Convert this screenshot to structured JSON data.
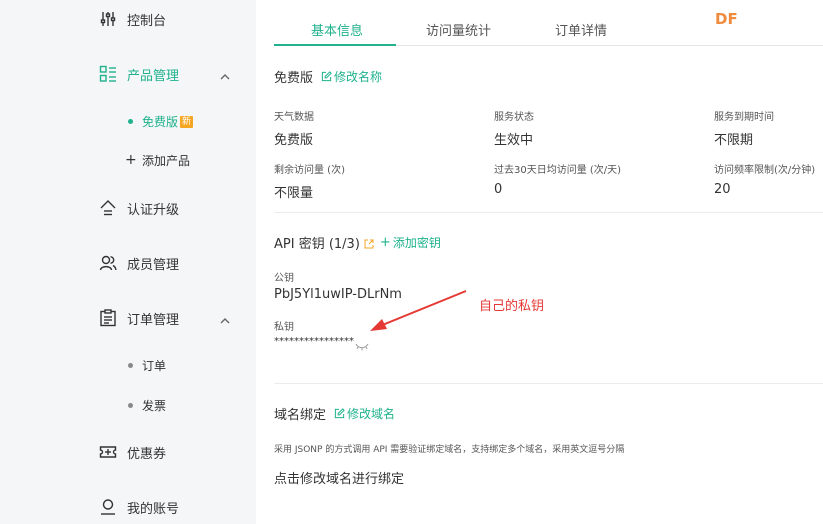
{
  "brand": "DF",
  "sidebar": {
    "items": [
      {
        "label": "控制台",
        "icon": "sliders-icon"
      },
      {
        "label": "产品管理",
        "icon": "grid-list-icon"
      },
      {
        "label": "认证升级",
        "icon": "upgrade-icon"
      },
      {
        "label": "成员管理",
        "icon": "members-icon"
      },
      {
        "label": "订单管理",
        "icon": "clipboard-icon"
      },
      {
        "label": "优惠券",
        "icon": "coupon-icon"
      },
      {
        "label": "我的账号",
        "icon": "user-icon"
      }
    ],
    "product_sub": {
      "free": "免费版",
      "new_badge": "新",
      "add": "添加产品"
    },
    "order_sub": {
      "orders": "订单",
      "invoice": "发票"
    }
  },
  "tabs": [
    "基本信息",
    "访问量统计",
    "订单详情"
  ],
  "plan": {
    "title": "免费版",
    "edit_name": "修改名称",
    "fields": [
      {
        "label": "天气数据",
        "value": "免费版"
      },
      {
        "label": "服务状态",
        "value": "生效中"
      },
      {
        "label": "服务到期时间",
        "value": "不限期"
      },
      {
        "label": "剩余访问量 (次)",
        "value": "不限量"
      },
      {
        "label": "过去30天日均访问量 (次/天)",
        "value": "0"
      },
      {
        "label": "访问频率限制(次/分钟)",
        "value": "20"
      }
    ]
  },
  "api": {
    "title": "API 密钥 (1/3)",
    "add_key": "添加密钥",
    "public_label": "公钥",
    "public_value": "PbJ5Yl1uwIP-DLrNm",
    "private_label": "私钥",
    "private_value": "****************"
  },
  "annotation": "自己的私钥",
  "domain": {
    "title": "域名绑定",
    "edit": "修改域名",
    "description": "采用 JSONP 的方式调用 API 需要验证绑定域名，支持绑定多个域名，采用英文逗号分隔",
    "hint": "点击修改域名进行绑定"
  },
  "colors": {
    "accent": "#1fb28d",
    "brand": "#f08a3c",
    "annotation": "#e53935",
    "badge": "#f5a623"
  }
}
